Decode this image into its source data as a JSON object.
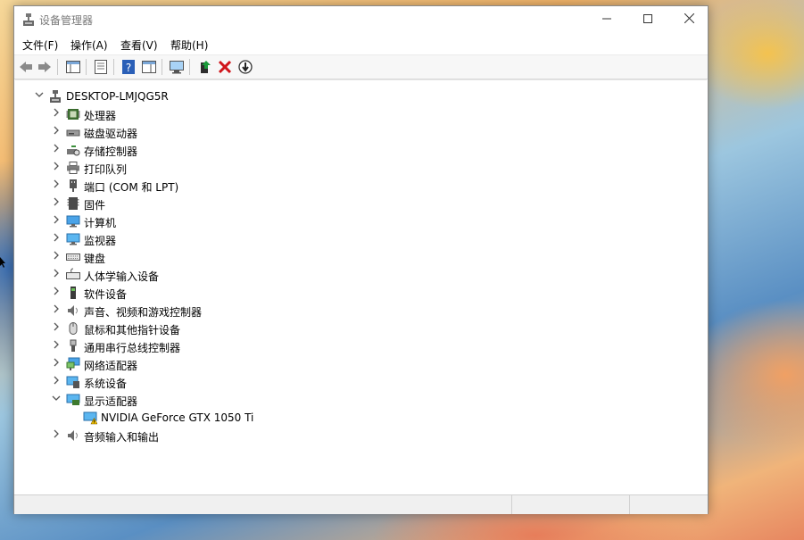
{
  "window": {
    "title": "设备管理器",
    "controls": {
      "minimize": "—",
      "maximize": "☐",
      "close": "✕"
    }
  },
  "menu": [
    "文件(F)",
    "操作(A)",
    "查看(V)",
    "帮助(H)"
  ],
  "toolbar": [
    "back-icon",
    "forward-icon",
    "show-hide-tree-icon",
    "properties-icon",
    "help-icon",
    "action-pane-icon",
    "scan-hardware-icon",
    "update-driver-icon",
    "uninstall-icon",
    "disable-device-icon"
  ],
  "tree": {
    "root": "DESKTOP-LMJQG5R",
    "items": [
      {
        "label": "处理器",
        "icon": "processor-icon",
        "expanded": false
      },
      {
        "label": "磁盘驱动器",
        "icon": "disk-drive-icon",
        "expanded": false
      },
      {
        "label": "存储控制器",
        "icon": "storage-controller-icon",
        "expanded": false
      },
      {
        "label": "打印队列",
        "icon": "printer-icon",
        "expanded": false
      },
      {
        "label": "端口 (COM 和 LPT)",
        "icon": "port-icon",
        "expanded": false
      },
      {
        "label": "固件",
        "icon": "firmware-icon",
        "expanded": false
      },
      {
        "label": "计算机",
        "icon": "computer-icon",
        "expanded": false
      },
      {
        "label": "监视器",
        "icon": "monitor-icon",
        "expanded": false
      },
      {
        "label": "键盘",
        "icon": "keyboard-icon",
        "expanded": false
      },
      {
        "label": "人体学输入设备",
        "icon": "hid-icon",
        "expanded": false
      },
      {
        "label": "软件设备",
        "icon": "software-device-icon",
        "expanded": false
      },
      {
        "label": "声音、视频和游戏控制器",
        "icon": "speaker-icon",
        "expanded": false
      },
      {
        "label": "鼠标和其他指针设备",
        "icon": "mouse-icon",
        "expanded": false
      },
      {
        "label": "通用串行总线控制器",
        "icon": "usb-icon",
        "expanded": false
      },
      {
        "label": "网络适配器",
        "icon": "network-icon",
        "expanded": false
      },
      {
        "label": "系统设备",
        "icon": "system-device-icon",
        "expanded": false
      },
      {
        "label": "显示适配器",
        "icon": "display-adapter-icon",
        "expanded": true,
        "children": [
          {
            "label": "NVIDIA GeForce GTX 1050 Ti",
            "icon": "display-adapter-warning-icon"
          }
        ]
      },
      {
        "label": "音频输入和输出",
        "icon": "speaker-icon",
        "expanded": false
      }
    ]
  },
  "colors": {
    "accent": "#1e6fd9",
    "warning": "#f5c400",
    "uninstall": "#d0141a",
    "update": "#1a9a3a"
  }
}
